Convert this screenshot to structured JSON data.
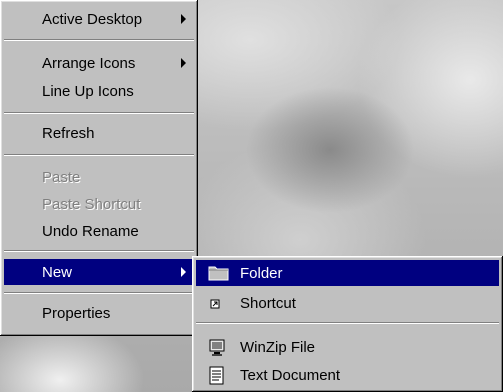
{
  "context_menu": {
    "items": [
      {
        "label": "Active Desktop",
        "has_submenu": true
      },
      {
        "label": "Arrange Icons",
        "has_submenu": true
      },
      {
        "label": "Line Up Icons"
      },
      {
        "label": "Refresh"
      },
      {
        "label": "Paste",
        "disabled": true
      },
      {
        "label": "Paste Shortcut",
        "disabled": true
      },
      {
        "label": "Undo Rename"
      },
      {
        "label": "New",
        "has_submenu": true,
        "highlighted": true
      },
      {
        "label": "Properties"
      }
    ]
  },
  "new_submenu": {
    "items": [
      {
        "label": "Folder",
        "icon": "folder-icon",
        "highlighted": true
      },
      {
        "label": "Shortcut",
        "icon": "shortcut-icon"
      },
      {
        "label": "WinZip File",
        "icon": "winzip-icon"
      },
      {
        "label": "Text Document",
        "icon": "text-document-icon"
      }
    ]
  },
  "colors": {
    "menu_face": "#c0c0c0",
    "highlight": "#000080",
    "disabled_text": "#808080"
  }
}
